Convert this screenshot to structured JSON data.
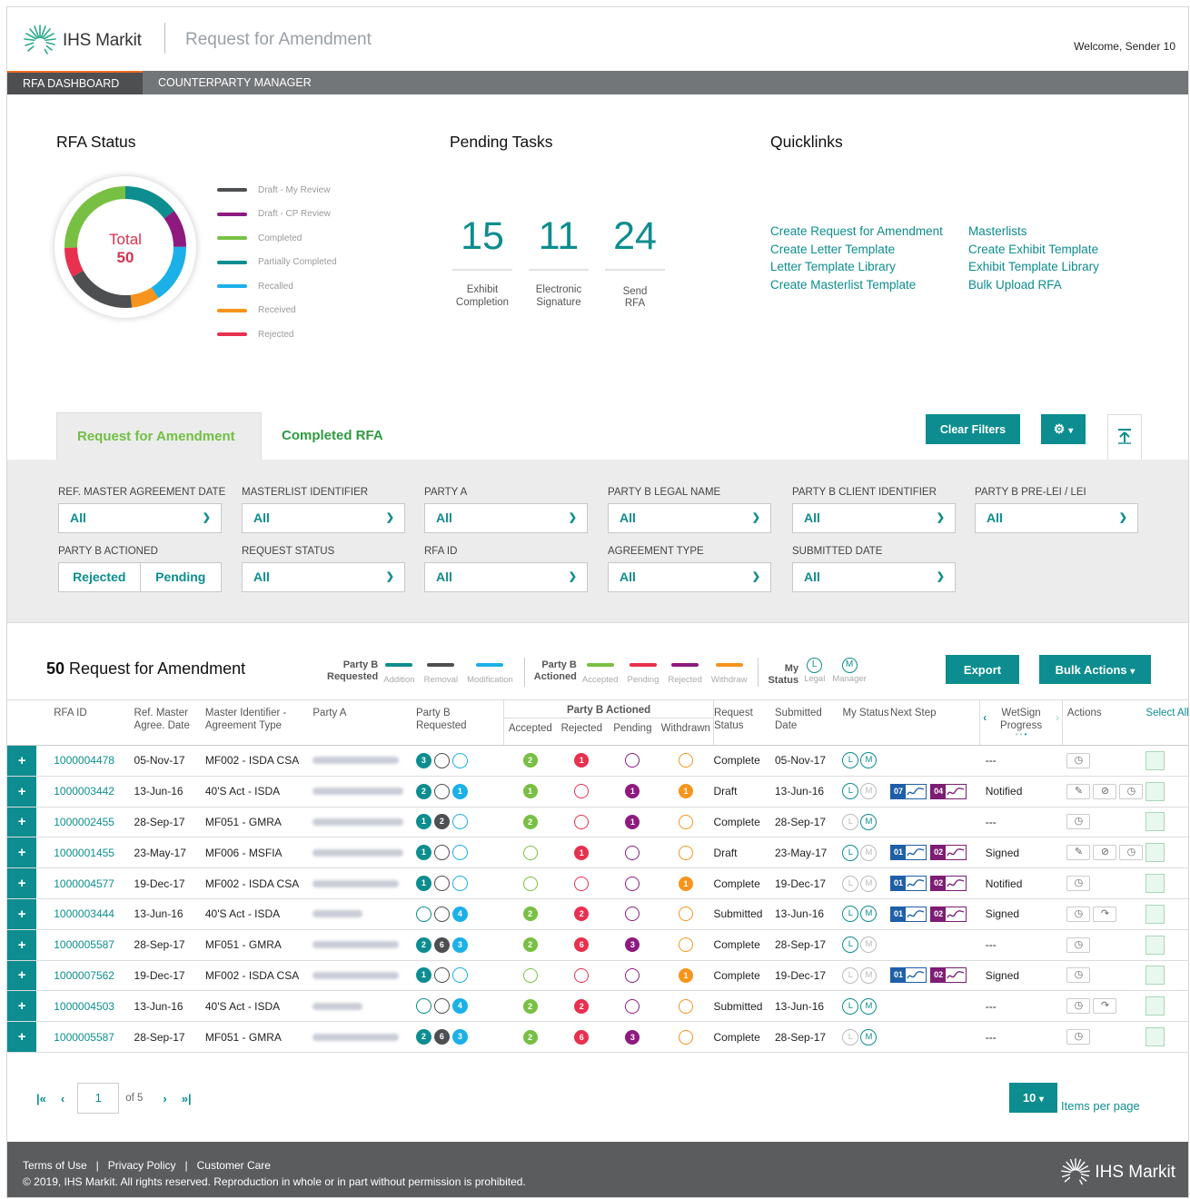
{
  "header": {
    "logo_text": "IHS Markit",
    "app_title": "Request for Amendment",
    "welcome": "Welcome, Sender 10"
  },
  "nav": [
    {
      "label": "RFA DASHBOARD",
      "active": true
    },
    {
      "label": "COUNTERPARTY MANAGER",
      "active": false
    }
  ],
  "rfa_status": {
    "title": "RFA Status",
    "total_label": "Total",
    "total_value": "50",
    "legend": [
      {
        "label": "Draft - My Review",
        "color": "#4d4f51"
      },
      {
        "label": "Draft - CP Review",
        "color": "#8e1a7f"
      },
      {
        "label": "Completed",
        "color": "#78c043"
      },
      {
        "label": "Partially Completed",
        "color": "#0d8d8f"
      },
      {
        "label": "Recalled",
        "color": "#1cb0e8"
      },
      {
        "label": "Received",
        "color": "#f7941d"
      },
      {
        "label": "Rejected",
        "color": "#e8304f"
      }
    ]
  },
  "pending_tasks": {
    "title": "Pending Tasks",
    "items": [
      {
        "value": "15",
        "label_1": "Exhibit",
        "label_2": "Completion"
      },
      {
        "value": "11",
        "label_1": "Electronic",
        "label_2": "Signature"
      },
      {
        "value": "24",
        "label_1": "Send",
        "label_2": "RFA"
      }
    ]
  },
  "quicklinks": {
    "title": "Quicklinks",
    "col1": [
      "Create Request for Amendment",
      "Create Letter Template",
      "Letter Template Library",
      "Create Masterlist Template"
    ],
    "col2": [
      "Masterlists",
      "Create Exhibit Template",
      "Exhibit Template Library",
      "Bulk Upload RFA"
    ]
  },
  "tabs": [
    {
      "label": "Request for Amendment",
      "active": true
    },
    {
      "label": "Completed RFA",
      "active": false
    }
  ],
  "toolbar": {
    "clear_filters": "Clear Filters",
    "settings_icon": "gear-icon",
    "collapse_icon": "collapse-up-icon"
  },
  "filters": {
    "row1": [
      {
        "label": "REF. MASTER AGREEMENT DATE",
        "value": "All"
      },
      {
        "label": "MASTERLIST IDENTIFIER",
        "value": "All"
      },
      {
        "label": "PARTY A",
        "value": "All"
      },
      {
        "label": "PARTY B LEGAL NAME",
        "value": "All"
      },
      {
        "label": "PARTY B CLIENT  IDENTIFIER",
        "value": "All"
      },
      {
        "label": "PARTY B PRE-LEI / LEI",
        "value": "All"
      }
    ],
    "actioned": {
      "label": "PARTY B ACTIONED",
      "options": [
        "Rejected",
        "Pending"
      ]
    },
    "row2": [
      {
        "label": "REQUEST STATUS",
        "value": "All"
      },
      {
        "label": "RFA ID",
        "value": "All"
      },
      {
        "label": "AGREEMENT TYPE",
        "value": "All"
      },
      {
        "label": "SUBMITTED DATE",
        "value": "All"
      }
    ]
  },
  "list": {
    "count": "50",
    "title": "Request for Amendment",
    "export": "Export",
    "bulk_actions": "Bulk Actions"
  },
  "key": {
    "requested_head_1": "Party B",
    "requested_head_2": "Requested",
    "requested": [
      {
        "label": "Addition",
        "color": "#0d8d8f"
      },
      {
        "label": "Removal",
        "color": "#4d4f51"
      },
      {
        "label": "Modification",
        "color": "#1cb0e8"
      }
    ],
    "actioned_head_1": "Party B",
    "actioned_head_2": "Actioned",
    "actioned": [
      {
        "label": "Accepted",
        "color": "#78c043"
      },
      {
        "label": "Pending",
        "color": "#e8304f"
      },
      {
        "label": "Rejected",
        "color": "#8e1a7f"
      },
      {
        "label": "Withdraw",
        "color": "#f7941d"
      }
    ],
    "status_head_1": "My",
    "status_head_2": "Status",
    "status": [
      {
        "glyph": "L",
        "label": "Legal"
      },
      {
        "glyph": "M",
        "label": "Manager"
      }
    ]
  },
  "table": {
    "headers": {
      "rfa_id": "RFA ID",
      "ref_master": "Ref. Master Agree. Date",
      "master_id": "Master Identifier - Agreement Type",
      "party_a": "Party A",
      "party_b_requested": "Party B Requested",
      "party_b_actioned": "Party B Actioned",
      "accepted": "Accepted",
      "rejected": "Rejected",
      "pending": "Pending",
      "withdrawn": "Withdrawn",
      "request_status": "Request Status",
      "submitted_date": "Submitted Date",
      "my_status": "My Status",
      "next_step": "Next Step",
      "wetsign": "WetSign Progress",
      "actions": "Actions",
      "select_all": "Select All"
    },
    "rows": [
      {
        "id": "1000004478",
        "ref": "05-Nov-17",
        "master": "MF002 - ISDA CSA",
        "party_a_w": 95,
        "req": [
          3,
          0,
          0
        ],
        "acc": 2,
        "rej": 1,
        "pen": 0,
        "wd": 0,
        "status": "Complete",
        "sub": "05-Nov-17",
        "L": true,
        "M": true,
        "chips": null,
        "next": "---",
        "actions": [
          "history"
        ]
      },
      {
        "id": "1000003442",
        "ref": "13-Jun-16",
        "master": "40'S Act - ISDA",
        "party_a_w": 100,
        "req": [
          2,
          0,
          1
        ],
        "acc": 1,
        "rej": 0,
        "pen": 1,
        "wd": 1,
        "status": "Draft",
        "sub": "13-Jun-16",
        "L": true,
        "M": false,
        "chips": [
          "07",
          "04"
        ],
        "next": "Notified",
        "actions": [
          "edit",
          "unlink",
          "history"
        ]
      },
      {
        "id": "1000002455",
        "ref": "28-Sep-17",
        "master": "MF051 - GMRA",
        "party_a_w": 100,
        "req": [
          1,
          2,
          0
        ],
        "acc": 2,
        "rej": 0,
        "pen": 1,
        "wd": 0,
        "status": "Complete",
        "sub": "28-Sep-17",
        "L": false,
        "M": true,
        "chips": null,
        "next": "---",
        "actions": [
          "history"
        ]
      },
      {
        "id": "1000001455",
        "ref": "23-May-17",
        "master": "MF006 - MSFIA",
        "party_a_w": 100,
        "req": [
          1,
          0,
          0
        ],
        "acc": 0,
        "rej": 1,
        "pen": 0,
        "wd": 0,
        "status": "Draft",
        "sub": "23-May-17",
        "L": true,
        "M": false,
        "chips": [
          "01",
          "02"
        ],
        "next": "Signed",
        "actions": [
          "edit",
          "unlink",
          "history"
        ]
      },
      {
        "id": "1000004577",
        "ref": "19-Dec-17",
        "master": "MF002 - ISDA CSA",
        "party_a_w": 95,
        "req": [
          1,
          0,
          0
        ],
        "acc": 0,
        "rej": 0,
        "pen": 0,
        "wd": 1,
        "status": "Complete",
        "sub": "19-Dec-17",
        "L": false,
        "M": false,
        "chips": [
          "01",
          "02"
        ],
        "next": "Notified",
        "actions": [
          "history"
        ]
      },
      {
        "id": "1000003444",
        "ref": "13-Jun-16",
        "master": "40'S Act - ISDA",
        "party_a_w": 55,
        "req": [
          0,
          0,
          4
        ],
        "acc": 2,
        "rej": 2,
        "pen": 0,
        "wd": 0,
        "status": "Submitted",
        "sub": "13-Jun-16",
        "L": true,
        "M": true,
        "chips": [
          "01",
          "02"
        ],
        "next": "Signed",
        "actions": [
          "history",
          "redo"
        ]
      },
      {
        "id": "1000005587",
        "ref": "28-Sep-17",
        "master": "MF051 - GMRA",
        "party_a_w": 95,
        "req": [
          2,
          6,
          3
        ],
        "acc": 2,
        "rej": 6,
        "pen": 3,
        "wd": 0,
        "status": "Complete",
        "sub": "28-Sep-17",
        "L": true,
        "M": false,
        "chips": null,
        "next": "---",
        "actions": [
          "history"
        ]
      },
      {
        "id": "1000007562",
        "ref": "19-Dec-17",
        "master": "MF002 - ISDA CSA",
        "party_a_w": 95,
        "req": [
          1,
          0,
          0
        ],
        "acc": 0,
        "rej": 0,
        "pen": 0,
        "wd": 1,
        "status": "Complete",
        "sub": "19-Dec-17",
        "L": false,
        "M": false,
        "chips": [
          "01",
          "02"
        ],
        "next": "Signed",
        "actions": [
          "history"
        ]
      },
      {
        "id": "1000004503",
        "ref": "13-Jun-16",
        "master": "40'S Act - ISDA",
        "party_a_w": 55,
        "req": [
          0,
          0,
          4
        ],
        "acc": 2,
        "rej": 2,
        "pen": 0,
        "wd": 0,
        "status": "Submitted",
        "sub": "13-Jun-16",
        "L": true,
        "M": true,
        "chips": null,
        "next": "---",
        "actions": [
          "history",
          "redo"
        ]
      },
      {
        "id": "1000005587",
        "ref": "28-Sep-17",
        "master": "MF051 - GMRA",
        "party_a_w": 95,
        "req": [
          2,
          6,
          3
        ],
        "acc": 2,
        "rej": 6,
        "pen": 3,
        "wd": 0,
        "status": "Complete",
        "sub": "28-Sep-17",
        "L": false,
        "M": true,
        "chips": null,
        "next": "---",
        "actions": [
          "history"
        ]
      }
    ],
    "wetsign_dash": "---"
  },
  "pager": {
    "page": "1",
    "of": "of 5",
    "per_page": "10",
    "per_page_label": "Items per page"
  },
  "footer": {
    "links": "Terms of Use   |   Privacy Policy   |   Customer Care",
    "copyright": "© 2019, IHS Markit. All rights reserved. Reproduction in whole or in part without permission is prohibited.",
    "logo_text": "IHS Markit"
  },
  "colors": {
    "teal": "#0d8d8f",
    "addition": "#0d8d8f",
    "removal": "#4d4f51",
    "modification": "#1cb0e8",
    "accepted": "#78c043",
    "pending": "#e8304f",
    "rejected": "#8e1a7f",
    "withdraw": "#f7941d"
  }
}
